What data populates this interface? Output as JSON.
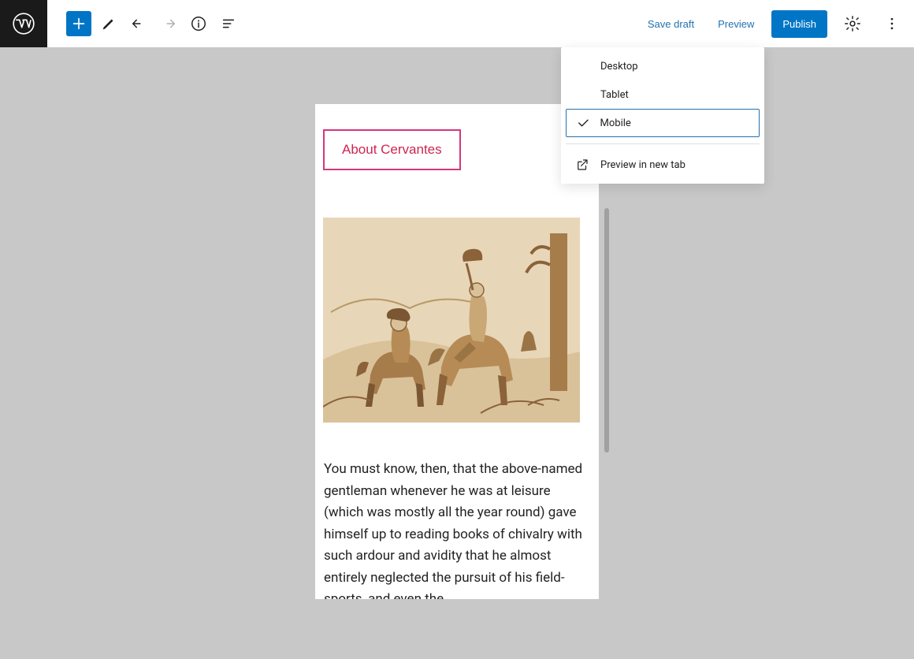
{
  "toolbar": {
    "save_draft": "Save draft",
    "preview": "Preview",
    "publish": "Publish"
  },
  "preview_menu": {
    "items": [
      "Desktop",
      "Tablet",
      "Mobile"
    ],
    "selected": "Mobile",
    "new_tab": "Preview in new tab"
  },
  "content": {
    "button_label": "About Cervantes",
    "body": "You must know, then, that the above-named gentleman whenever he was at leisure (which was mostly all the year round) gave himself up to reading books of chivalry with such ardour and avidity that he almost entirely neglected the pursuit of his field-sports, and even the"
  }
}
